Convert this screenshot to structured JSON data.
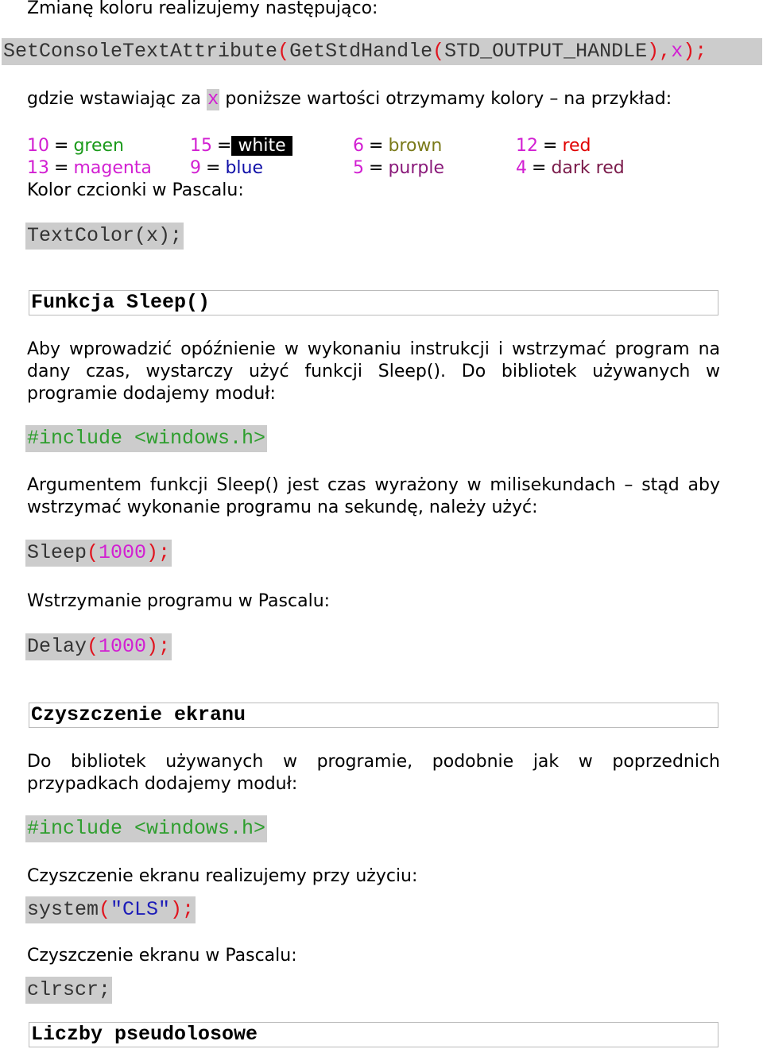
{
  "intro": "Zmianę koloru realizujemy następująco:",
  "code_set_console": {
    "parts": [
      "SetConsoleTextAttribute",
      "(",
      "GetStdHandle",
      "(",
      "STD_OUTPUT_HANDLE",
      ")",
      ",",
      "x",
      ")",
      ";"
    ]
  },
  "insert_sentence": {
    "before": "gdzie wstawiając za ",
    "var": "x",
    "after": " poniższe wartości otrzymamy kolory – na przykład:"
  },
  "colors": [
    {
      "code": "10",
      "name": "green",
      "color": "#1a9a1a"
    },
    {
      "code": "15",
      "name": "white",
      "color": "#ffffff",
      "background": "#000000"
    },
    {
      "code": "6",
      "name": "brown",
      "color": "#7a7a1a"
    },
    {
      "code": "12",
      "name": "red",
      "color": "#e00000"
    },
    {
      "code": "13",
      "name": "magenta",
      "color": "#d21fd2"
    },
    {
      "code": "9",
      "name": "blue",
      "color": "#1010a8"
    },
    {
      "code": "5",
      "name": "purple",
      "color": "#8a1a7a"
    },
    {
      "code": "4",
      "name": "dark red",
      "color": "#7a1a4a"
    }
  ],
  "equals": "=",
  "pascal_color_label": "Kolor czcionki w Pascalu:",
  "code_textcolor": "TextColor(x);",
  "section_sleep": {
    "title": "Funkcja Sleep()",
    "paragraph": "Aby wprowadzić opóźnienie w wykonaniu instrukcji i wstrzymać program na dany czas, wystarczy użyć funkcji Sleep(). Do bibliotek używanych w programie dodajemy moduł:",
    "include": "#include <windows.h>",
    "paragraph2": "Argumentem funkcji Sleep() jest czas wyrażony w milisekundach – stąd aby wstrzymać wykonanie programu na sekundę, należy użyć:",
    "code_sleep": {
      "fn": "Sleep",
      "open": "(",
      "arg": "1000",
      "close": ")",
      "semi": ";"
    },
    "pascal_label": "Wstrzymanie programu w Pascalu:",
    "code_delay": {
      "fn": "Delay",
      "open": "(",
      "arg": "1000",
      "close": ")",
      "semi": ";"
    }
  },
  "section_clear": {
    "title": "Czyszczenie ekranu",
    "paragraph": "Do bibliotek używanych w programie, podobnie jak w poprzednich przypadkach dodajemy moduł:",
    "include": "#include <windows.h>",
    "usage_label": "Czyszczenie ekranu realizujemy przy użyciu:",
    "code_system": {
      "fn": "system",
      "open": "(",
      "arg": "\"CLS\"",
      "close": ")",
      "semi": ";"
    },
    "pascal_label": "Czyszczenie ekranu w Pascalu:",
    "code_clrscr": "clrscr;"
  },
  "section_random": {
    "title": "Liczby pseudolosowe"
  }
}
